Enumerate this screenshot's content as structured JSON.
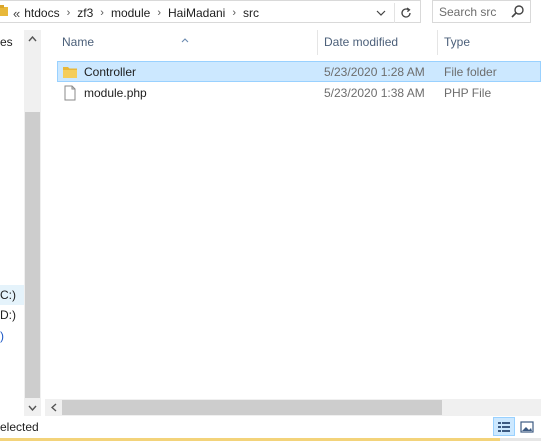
{
  "address_bar": {
    "overflow_chevron": "«",
    "crumbs": [
      "htdocs",
      "zf3",
      "module",
      "HaiMadani",
      "src"
    ],
    "separator": "›",
    "folder_icon": "folder-icon",
    "dropdown_icon": "chevron-down-icon",
    "refresh_icon": "refresh-icon"
  },
  "search": {
    "placeholder": "Search src",
    "icon": "search-icon"
  },
  "nav_pane": {
    "partial_labels": [
      "es",
      "C:)",
      "D:)",
      ")"
    ]
  },
  "columns": {
    "name": "Name",
    "date_modified": "Date modified",
    "type": "Type",
    "sort_indicator": "sort-ascending-icon"
  },
  "files": [
    {
      "name": "Controller",
      "date_modified": "5/23/2020 1:28 AM",
      "type": "File folder",
      "icon": "folder-icon",
      "selected": true
    },
    {
      "name": "module.php",
      "date_modified": "5/23/2020 1:38 AM",
      "type": "PHP File",
      "icon": "file-icon",
      "selected": false
    }
  ],
  "status_bar": {
    "text": "elected",
    "views": [
      "details-view-icon",
      "large-icons-view-icon"
    ],
    "active_view": "details-view-icon"
  },
  "colors": {
    "selection_fill": "#cce8ff",
    "selection_border": "#99d1ff",
    "header_text": "#4c607a",
    "secondary_text": "#6d6d6d",
    "folder_yellow": "#e8b83a"
  }
}
